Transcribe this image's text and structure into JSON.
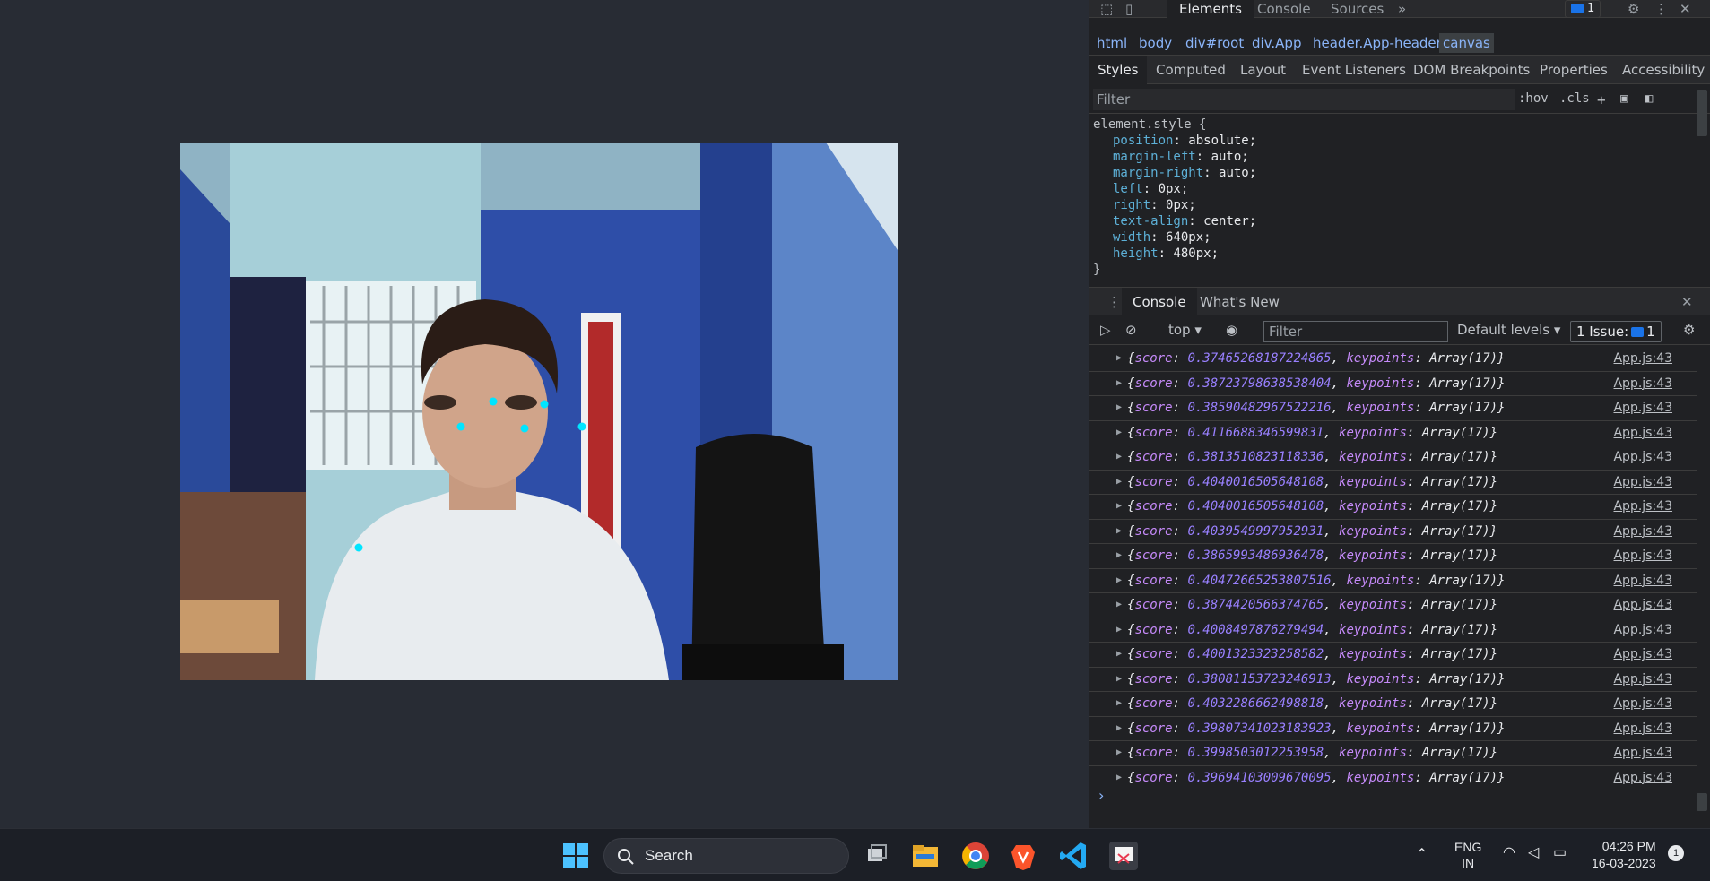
{
  "devtools": {
    "top_tabs": [
      "Elements",
      "Console",
      "Sources"
    ],
    "issue_count": "1",
    "breadcrumbs": [
      "html",
      "body",
      "div#root",
      "div.App",
      "header.App-header",
      "canvas"
    ],
    "style_tabs": [
      "Styles",
      "Computed",
      "Layout",
      "Event Listeners",
      "DOM Breakpoints",
      "Properties",
      "Accessibility"
    ],
    "filter_placeholder": "Filter",
    "hov_label": ":hov",
    "cls_label": ".cls",
    "element_selector": "element.style {",
    "close_brace": "}",
    "declarations": [
      {
        "prop": "position",
        "val": "absolute;"
      },
      {
        "prop": "margin-left",
        "val": "auto;"
      },
      {
        "prop": "margin-right",
        "val": "auto;"
      },
      {
        "prop": "left",
        "val": "0px;"
      },
      {
        "prop": "right",
        "val": "0px;"
      },
      {
        "prop": "text-align",
        "val": "center;"
      },
      {
        "prop": "width",
        "val": "640px;"
      },
      {
        "prop": "height",
        "val": "480px;"
      }
    ],
    "drawer_tabs": [
      "Console",
      "What's New"
    ],
    "console_context": "top",
    "console_filter_placeholder": "Filter",
    "default_levels": "Default levels",
    "issues_label": "1 Issue:",
    "issues_count": "1",
    "log_source": "App.js:43",
    "log_score_key": "score",
    "log_keypoints_key": "keypoints",
    "log_keypoints_val": "Array(17)",
    "logs": [
      "0.37465268187224865",
      "0.38723798638538404",
      "0.38590482967522216",
      "0.4116688346599831",
      "0.3813510823118336",
      "0.4040016505648108",
      "0.4040016505648108",
      "0.4039549997952931",
      "0.3865993486936478",
      "0.40472665253807516",
      "0.3874420566374765",
      "0.4008497876279494",
      "0.4001323323258582",
      "0.38081153723246913",
      "0.4032286662498818",
      "0.39807341023183923",
      "0.3998503012253958",
      "0.39694103009670095"
    ]
  },
  "taskbar": {
    "search_label": "Search",
    "lang_line1": "ENG",
    "lang_line2": "IN",
    "time": "04:26 PM",
    "date": "16-03-2023",
    "notification_count": "1"
  },
  "colors": {
    "app_bg": "#282c34",
    "devtools_bg": "#202124",
    "link_blue": "#8ab4f8",
    "keypoint": "#00e5ff"
  }
}
